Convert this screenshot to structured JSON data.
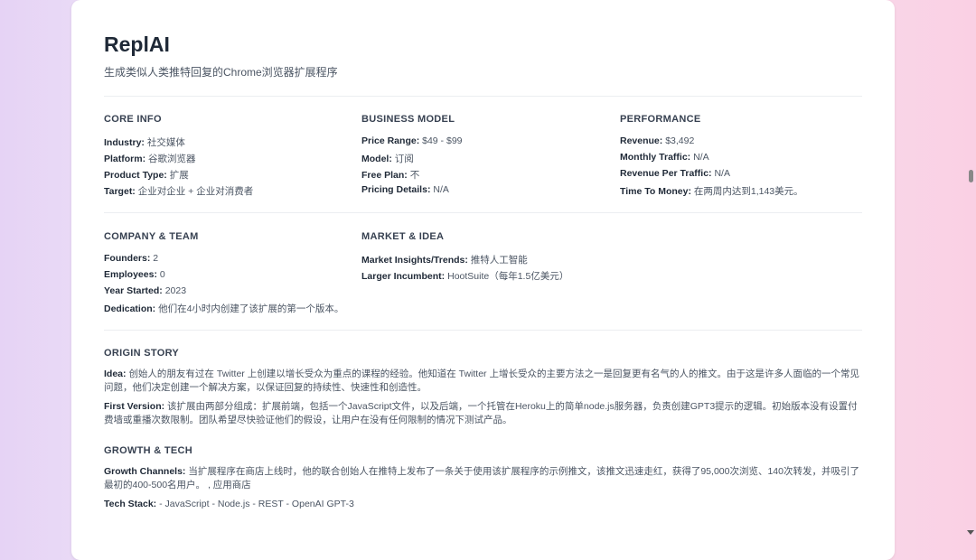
{
  "header": {
    "title": "ReplAI",
    "subtitle": "生成类似人类推特回复的Chrome浏览器扩展程序"
  },
  "core_info": {
    "heading": "CORE INFO",
    "fields": [
      {
        "label": "Industry:",
        "value": "社交媒体"
      },
      {
        "label": "Platform:",
        "value": "谷歌浏览器"
      },
      {
        "label": "Product Type:",
        "value": "扩展"
      },
      {
        "label": "Target:",
        "value": "企业对企业 + 企业对消费者"
      }
    ]
  },
  "business_model": {
    "heading": "BUSINESS MODEL",
    "fields": [
      {
        "label": "Price Range:",
        "value": "$49 - $99"
      },
      {
        "label": "Model:",
        "value": "订阅"
      },
      {
        "label": "Free Plan:",
        "value": "不"
      },
      {
        "label": "Pricing Details:",
        "value": "N/A"
      }
    ]
  },
  "performance": {
    "heading": "PERFORMANCE",
    "fields": [
      {
        "label": "Revenue:",
        "value": "$3,492"
      },
      {
        "label": "Monthly Traffic:",
        "value": "N/A"
      },
      {
        "label": "Revenue Per Traffic:",
        "value": "N/A"
      },
      {
        "label": "Time To Money:",
        "value": "在两周内达到1,143美元。"
      }
    ]
  },
  "company_team": {
    "heading": "COMPANY & TEAM",
    "fields": [
      {
        "label": "Founders:",
        "value": "2"
      },
      {
        "label": "Employees:",
        "value": "0"
      },
      {
        "label": "Year Started:",
        "value": "2023"
      },
      {
        "label": "Dedication:",
        "value": "他们在4小时内创建了该扩展的第一个版本。"
      }
    ]
  },
  "market_idea": {
    "heading": "MARKET & IDEA",
    "fields": [
      {
        "label": "Market Insights/Trends:",
        "value": "推特人工智能"
      },
      {
        "label": "Larger Incumbent:",
        "value": "HootSuite（每年1.5亿美元）"
      }
    ]
  },
  "origin_story": {
    "heading": "ORIGIN STORY",
    "idea_label": "Idea:",
    "idea_text": "创始人的朋友有过在 Twitter 上创建以增长受众为重点的课程的经验。他知道在 Twitter 上增长受众的主要方法之一是回复更有名气的人的推文。由于这是许多人面临的一个常见问题，他们决定创建一个解决方案，以保证回复的持续性、快速性和创造性。",
    "first_version_label": "First Version:",
    "first_version_text": "该扩展由两部分组成：扩展前端，包括一个JavaScript文件，以及后端，一个托管在Heroku上的简单node.js服务器，负责创建GPT3提示的逻辑。初始版本没有设置付费墙或重播次数限制。团队希望尽快验证他们的假设，让用户在没有任何限制的情况下测试产品。"
  },
  "growth_tech": {
    "heading": "GROWTH & TECH",
    "growth_label": "Growth Channels:",
    "growth_text": "当扩展程序在商店上线时，他的联合创始人在推特上发布了一条关于使用该扩展程序的示例推文，该推文迅速走红，获得了95,000次浏览、140次转发，并吸引了最初的400-500名用户。 , 应用商店",
    "tech_label": "Tech Stack:",
    "tech_text": "- JavaScript - Node.js - REST - OpenAI GPT-3"
  }
}
